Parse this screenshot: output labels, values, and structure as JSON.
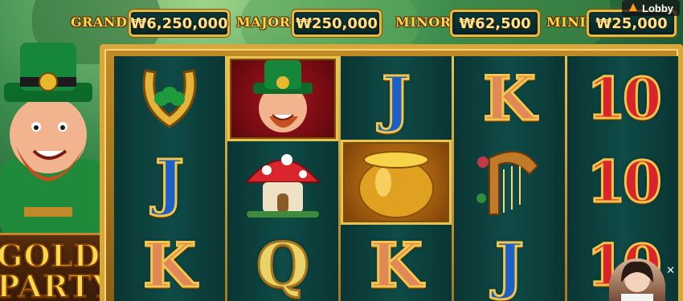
{
  "jackpots": [
    {
      "label": "GRAND",
      "value": "₩6,250,000"
    },
    {
      "label": "MAJOR",
      "value": "₩250,000"
    },
    {
      "label": "MINOR",
      "value": "₩62,500"
    },
    {
      "label": "MINI",
      "value": "₩25,000"
    }
  ],
  "lobby": {
    "label": "Lobby",
    "icon": "lobby-icon"
  },
  "logo": {
    "line1": "GOLD",
    "line2": "PARTY"
  },
  "reels": [
    [
      "horseshoe",
      "J",
      "K"
    ],
    [
      "leprechaun",
      "mushroom-house",
      "Q"
    ],
    [
      "J",
      "pot-of-gold",
      "K"
    ],
    [
      "K",
      "harp",
      "J"
    ],
    [
      "10",
      "10",
      "10"
    ]
  ],
  "overlay": {
    "close_label": "✕"
  },
  "colors": {
    "frame": "#d9a63a",
    "jackpot_text": "#ffe28a",
    "reel_bg": "#0b3f3c"
  }
}
